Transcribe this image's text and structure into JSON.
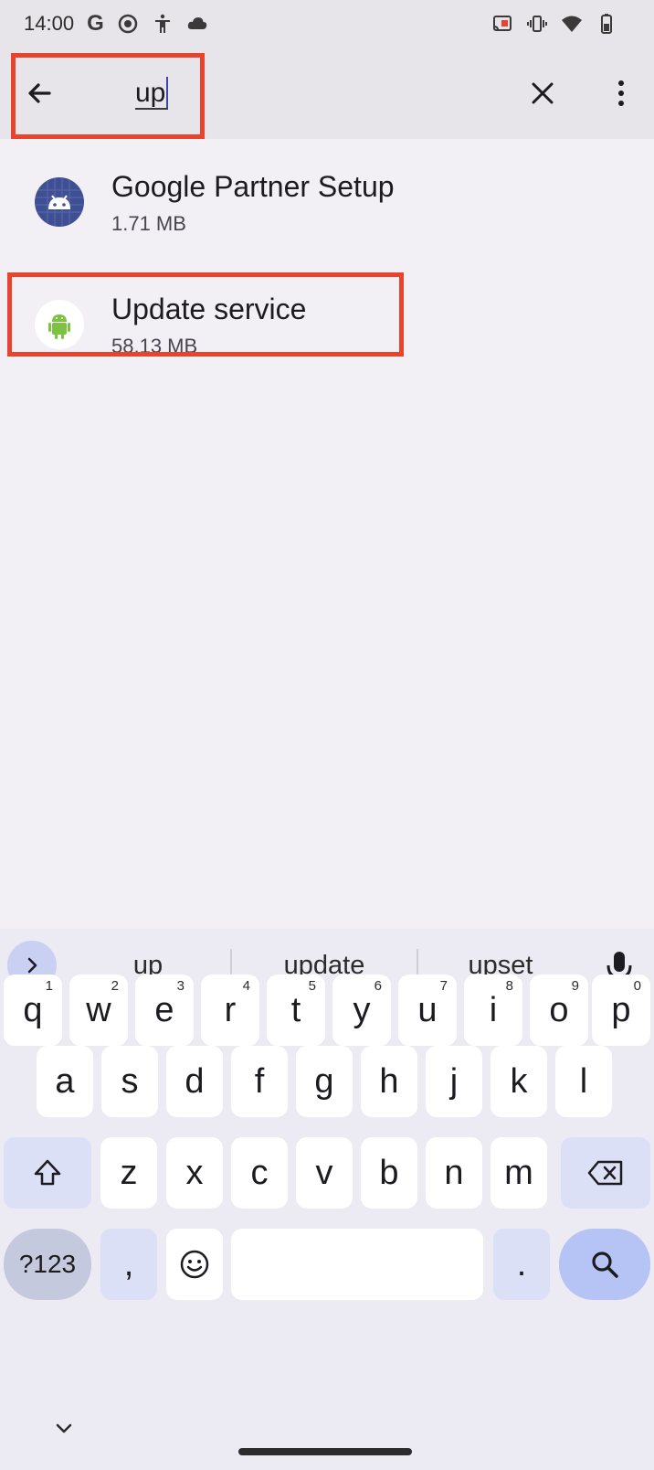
{
  "status_bar": {
    "time": "14:00",
    "google_letter": "G"
  },
  "search": {
    "query": "up"
  },
  "apps": [
    {
      "name": "Google Partner Setup",
      "size": "1.71 MB",
      "icon": "android-icon-dark"
    },
    {
      "name": "Update service",
      "size": "58.13 MB",
      "icon": "android-icon-green"
    }
  ],
  "keyboard": {
    "suggestions": [
      "up",
      "update",
      "upset"
    ],
    "row1": [
      {
        "k": "q",
        "h": "1"
      },
      {
        "k": "w",
        "h": "2"
      },
      {
        "k": "e",
        "h": "3"
      },
      {
        "k": "r",
        "h": "4"
      },
      {
        "k": "t",
        "h": "5"
      },
      {
        "k": "y",
        "h": "6"
      },
      {
        "k": "u",
        "h": "7"
      },
      {
        "k": "i",
        "h": "8"
      },
      {
        "k": "o",
        "h": "9"
      },
      {
        "k": "p",
        "h": "0"
      }
    ],
    "row2": [
      "a",
      "s",
      "d",
      "f",
      "g",
      "h",
      "j",
      "k",
      "l"
    ],
    "row3": [
      "z",
      "x",
      "c",
      "v",
      "b",
      "n",
      "m"
    ],
    "symbols_label": "?123",
    "comma": ",",
    "period": "."
  },
  "colors": {
    "highlight": "#e8432c",
    "accent": "#3b47a8",
    "search_key": "#b6c4f5"
  }
}
